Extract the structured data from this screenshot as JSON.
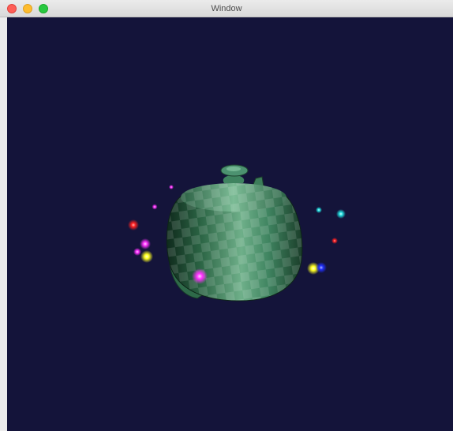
{
  "window": {
    "title": "Window"
  },
  "colors": {
    "background": "#14143a",
    "titlebar": "#e3e3e3",
    "close": "#fe5f57",
    "minimize": "#febc2e",
    "maximize": "#28c840",
    "teapot": "#2f6e4a"
  },
  "icons": {
    "close": "close-icon",
    "minimize": "minimize-icon",
    "maximize": "maximize-icon"
  },
  "light_colors": [
    "#ff2020",
    "#ff30ff",
    "#ffff20",
    "#20e0e0",
    "#2030ff"
  ]
}
